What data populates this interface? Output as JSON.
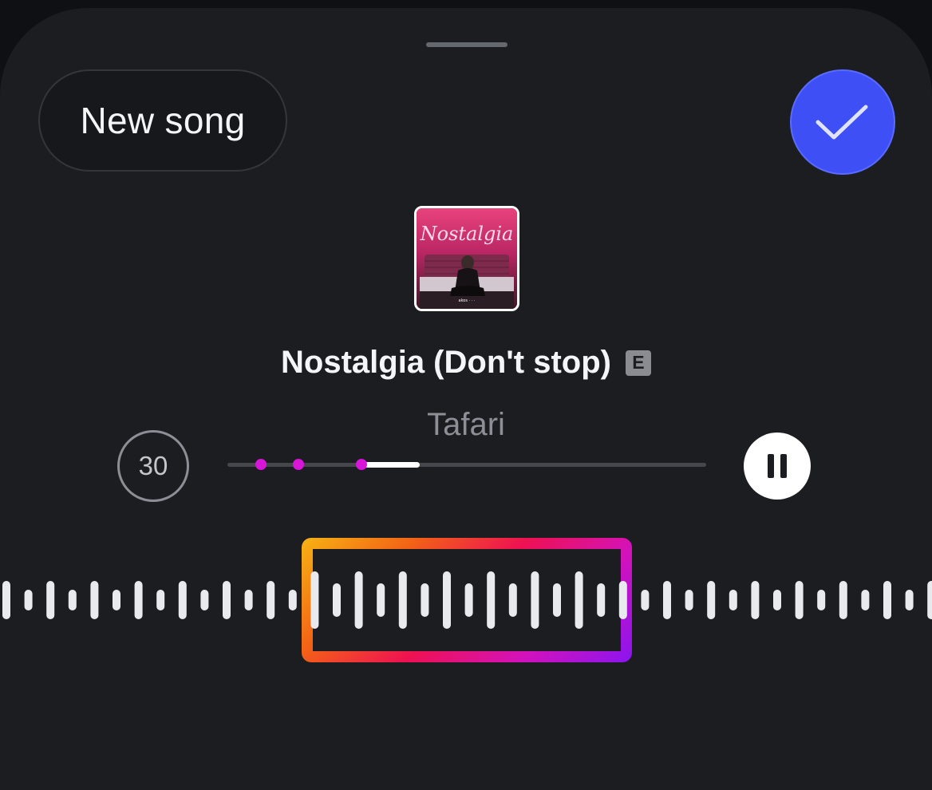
{
  "header": {
    "new_song_label": "New song",
    "confirm_icon": "checkmark-icon"
  },
  "track": {
    "title": "Nostalgia (Don't stop)",
    "explicit_badge": "E",
    "artist": "Tafari",
    "cover_art_text": "Nostalgia",
    "cover_art_small_text": "akos · · ·"
  },
  "player": {
    "clip_duration": "30",
    "pause_icon": "pause-icon",
    "progress_fraction": 0.122,
    "progress_start_fraction": 0.28,
    "marker_fractions": [
      0.07,
      0.148,
      0.28
    ]
  },
  "colors": {
    "accent_blue": "#3d4ff5",
    "marker_magenta": "#d816d8",
    "selector_gradient": [
      "#f7b414",
      "#f36316",
      "#ee1152",
      "#d312bb",
      "#8a15f0"
    ]
  },
  "waveform": {
    "selection_start_fraction": 0.33,
    "selection_end_fraction": 0.67
  }
}
